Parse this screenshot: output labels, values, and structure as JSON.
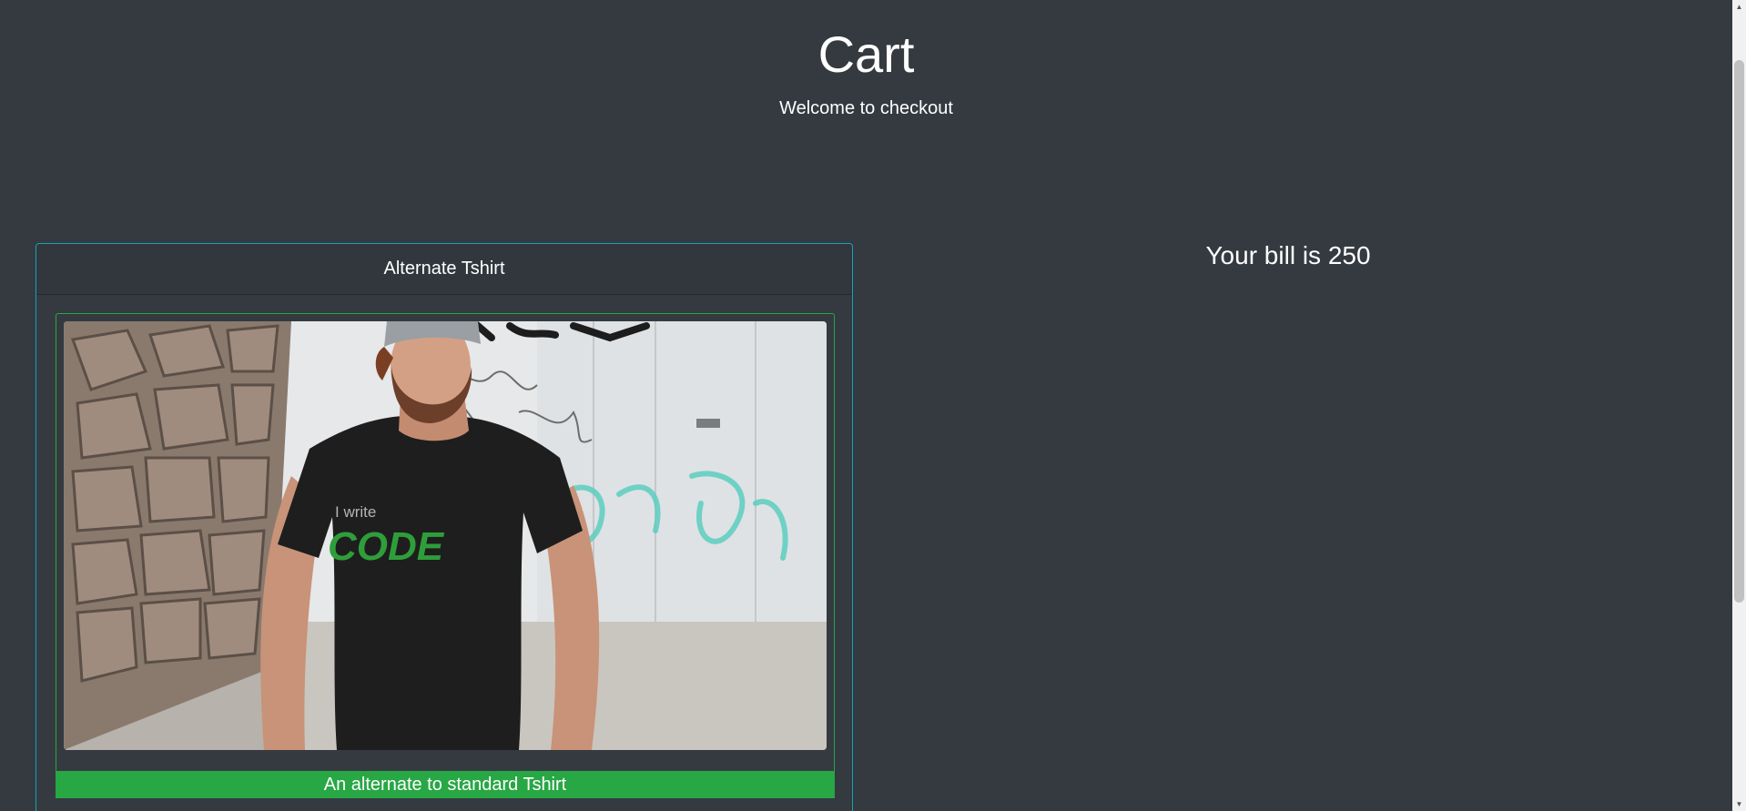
{
  "header": {
    "title": "Cart",
    "subtitle": "Welcome to checkout"
  },
  "product": {
    "name": "Alternate Tshirt",
    "description": "An alternate to standard Tshirt",
    "image": {
      "shirt_text_line1": "I write",
      "shirt_text_line2": "CODE"
    }
  },
  "bill": {
    "text": "Your bill is 250"
  },
  "colors": {
    "background": "#343a40",
    "card_border": "#17a2b8",
    "accent_green": "#28a745"
  }
}
